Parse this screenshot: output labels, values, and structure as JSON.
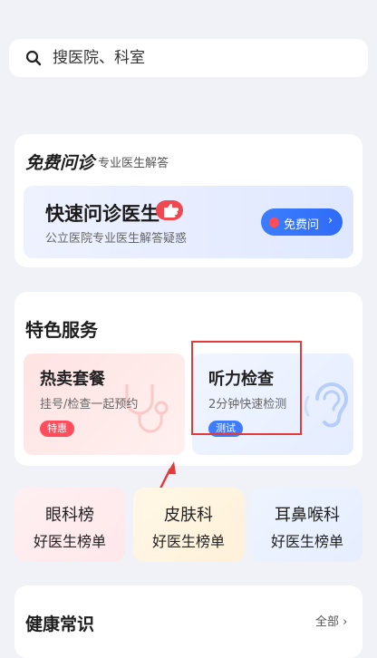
{
  "search": {
    "placeholder": "搜医院、科室"
  },
  "consult": {
    "title": "免费问诊",
    "subtitle": "专业医生解答",
    "quick_title": "快速问诊医生",
    "quick_desc": "公立医院专业医生解答疑惑",
    "free_button": "免费问",
    "free_chevron": "›"
  },
  "services": {
    "title": "特色服务",
    "items": [
      {
        "title": "热卖套餐",
        "desc": "挂号/检查一起预约",
        "tag": "特惠"
      },
      {
        "title": "听力检查",
        "desc": "2分钟快速检测",
        "tag": "测试"
      }
    ]
  },
  "ranks": [
    {
      "title": "眼科榜",
      "sub": "好医生榜单"
    },
    {
      "title": "皮肤科",
      "sub": "好医生榜单"
    },
    {
      "title": "耳鼻喉科",
      "sub": "好医生榜单"
    }
  ],
  "health": {
    "title": "健康常识",
    "all": "全部",
    "chevron": "›"
  },
  "colors": {
    "accent": "#2f6cf6",
    "hot": "#ff4d5c",
    "highlight": "#e23b3b"
  }
}
